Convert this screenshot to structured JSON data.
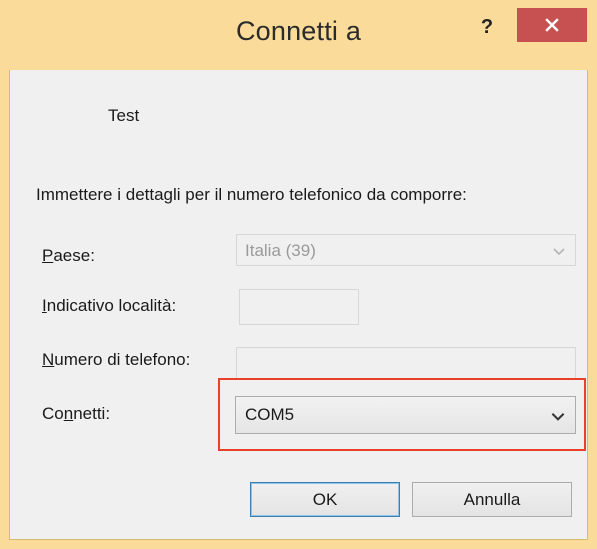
{
  "window": {
    "title": "Connetti a",
    "help_label": "?",
    "close_icon": "close-icon"
  },
  "entry_name": "Test",
  "instructions": "Immettere i dettagli per il numero telefonico da comporre:",
  "fields": {
    "country": {
      "accesskey": "P",
      "label_rest": "aese:",
      "value": "Italia (39)",
      "enabled": false
    },
    "area_code": {
      "accesskey": "I",
      "label_rest": "ndicativo località:",
      "value": "",
      "enabled": false
    },
    "phone_number": {
      "accesskey": "N",
      "label_rest": "umero di telefono:",
      "value": "",
      "enabled": false
    },
    "connect_using": {
      "label_start": "Co",
      "accesskey": "n",
      "label_rest": "netti:",
      "value": "COM5",
      "enabled": true
    }
  },
  "buttons": {
    "ok": "OK",
    "cancel": "Annulla"
  },
  "colors": {
    "titlebar": "#fadb9a",
    "close_button": "#c75050",
    "highlight": "#e8402a",
    "client": "#f0f0f0"
  }
}
